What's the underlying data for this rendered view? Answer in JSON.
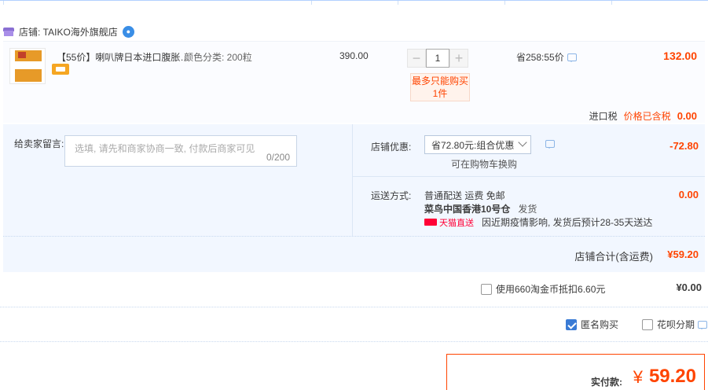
{
  "shop": {
    "label": "店铺: TAIKO海外旗舰店"
  },
  "item": {
    "title": "【55价】喇叭牌日本进口腹胀…",
    "variant": "颜色分类: 200粒",
    "unit_price": "390.00",
    "quantity": "1",
    "qty_minus": "−",
    "qty_plus": "+",
    "qty_warning": "最多只能购买1件",
    "saving": "省258:55价",
    "total": "132.00",
    "tax_label": "进口税",
    "tax_note": "价格已含税",
    "tax_value": "0.00"
  },
  "message": {
    "label": "给卖家留言:",
    "placeholder": "选填, 请先和商家协商一致, 付款后商家可见",
    "count": "0/200"
  },
  "promo": {
    "label": "店铺优惠:",
    "selected": "省72.80元:组合优惠",
    "sub": "可在购物车换购",
    "value": "-72.80"
  },
  "shipping": {
    "label": "运送方式:",
    "line1": "普通配送 运费 免邮",
    "warehouse": "菜鸟中国香港10号仓",
    "ship_status": "发货",
    "tmall_tag": "天猫直送",
    "note": "因近期疫情影响, 发货后预计28-35天送达",
    "value": "0.00"
  },
  "subtotal": {
    "label": "店铺合计(含运费)",
    "value": "¥59.20"
  },
  "coins": {
    "label": "使用660淘金币抵扣6.60元",
    "value": "¥0.00"
  },
  "options": {
    "anonymous": "匿名购买",
    "huabei": "花呗分期"
  },
  "pay": {
    "label": "实付款:",
    "currency": "¥",
    "value": "59.20"
  },
  "colors": {
    "accent": "#ff4400",
    "panel": "#f2f7ff",
    "check": "#3a7bd5"
  }
}
